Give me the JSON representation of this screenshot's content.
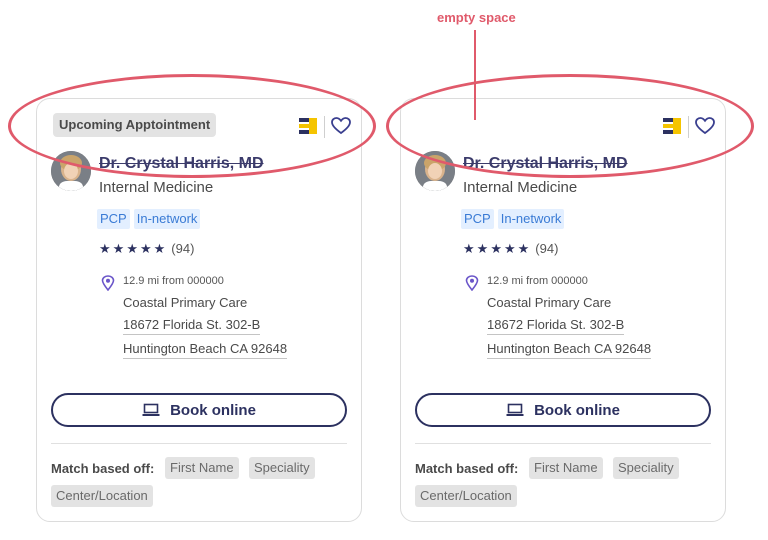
{
  "annotation": {
    "text": "empty space",
    "color": "#e05a6b"
  },
  "cards": [
    {
      "badge": "Upcoming Apptointment",
      "doctor_name": "Dr. Crystal Harris, MD",
      "specialty": "Internal Medicine",
      "tags": [
        "PCP",
        "In-network"
      ],
      "stars": 5,
      "rating_count": "(94)",
      "distance": "12.9 mi from 000000",
      "practice": "Coastal Primary Care",
      "address_line1": "18672 Florida St. 302-B",
      "address_line2": "Huntington Beach CA 92648",
      "book_label": "Book online",
      "match_label": "Match based off:",
      "match_chips": [
        "First Name",
        "Speciality",
        "Center/Location"
      ]
    },
    {
      "badge": "",
      "doctor_name": "Dr. Crystal Harris, MD",
      "specialty": "Internal Medicine",
      "tags": [
        "PCP",
        "In-network"
      ],
      "stars": 5,
      "rating_count": "(94)",
      "distance": "12.9 mi from 000000",
      "practice": "Coastal Primary Care",
      "address_line1": "18672 Florida St. 302-B",
      "address_line2": "Huntington Beach CA 92648",
      "book_label": "Book online",
      "match_label": "Match based off:",
      "match_chips": [
        "First Name",
        "Speciality",
        "Center/Location"
      ]
    }
  ],
  "colors": {
    "brand_navy": "#2c3160",
    "tag_blue": "#3a7bd5",
    "highlight_red": "#e05a6b",
    "logo_yellow": "#f5c400"
  },
  "icons": [
    "logo-icon",
    "heart-icon",
    "avatar",
    "star-icon",
    "pin-icon",
    "laptop-icon"
  ]
}
